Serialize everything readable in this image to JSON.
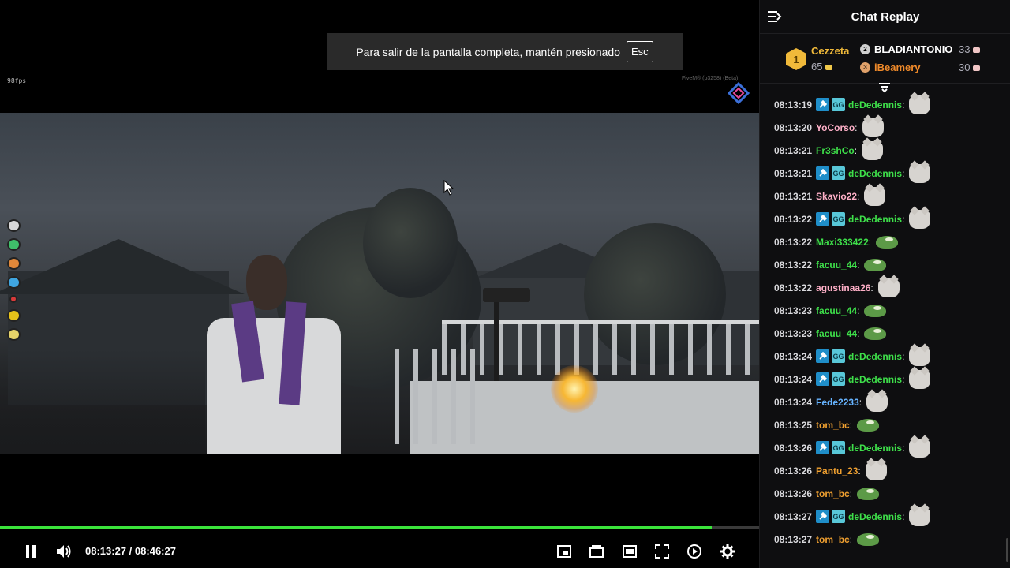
{
  "fullscreen_notice": {
    "text": "Para salir de la pantalla completa, mantén presionado",
    "key": "Esc"
  },
  "game": {
    "fps": "98fps",
    "watermark": "FiveM® (b3258) (Beta)"
  },
  "player": {
    "progress_fraction": 0.938,
    "current_time": "08:13:27",
    "separator": "/",
    "duration": "08:46:27",
    "colors": {
      "progress": "#3be43b"
    },
    "controls": [
      "pause-icon",
      "volume-icon",
      "miniplayer-icon",
      "theater-icon",
      "window-icon",
      "fullscreen-icon",
      "playback-speed-icon",
      "gear-icon"
    ]
  },
  "chat": {
    "title": "Chat Replay",
    "leaderboard": {
      "first": {
        "rank": "1",
        "name": "Cezzeta",
        "points": "65"
      },
      "others": [
        {
          "rank": "2",
          "name": "BLADIANTONIO",
          "points": "33",
          "color": "#ffffff"
        },
        {
          "rank": "3",
          "name": "iBeamery",
          "points": "30",
          "color": "#f08a2a"
        }
      ]
    },
    "messages": [
      {
        "time": "08:13:19",
        "user": "deDedennis",
        "color": "#3ee04a",
        "badges": true,
        "emote": "cat"
      },
      {
        "time": "08:13:20",
        "user": "YoCorso",
        "color": "#ffb0c8",
        "badges": false,
        "emote": "cat"
      },
      {
        "time": "08:13:21",
        "user": "Fr3shCo",
        "color": "#3ee04a",
        "badges": false,
        "emote": "cat"
      },
      {
        "time": "08:13:21",
        "user": "deDedennis",
        "color": "#3ee04a",
        "badges": true,
        "emote": "cat"
      },
      {
        "time": "08:13:21",
        "user": "Skavio22",
        "color": "#ffb0c8",
        "badges": false,
        "emote": "cat"
      },
      {
        "time": "08:13:22",
        "user": "deDedennis",
        "color": "#3ee04a",
        "badges": true,
        "emote": "cat"
      },
      {
        "time": "08:13:22",
        "user": "Maxi333422",
        "color": "#3ee04a",
        "badges": false,
        "emote": "frog"
      },
      {
        "time": "08:13:22",
        "user": "facuu_44",
        "color": "#3ee04a",
        "badges": false,
        "emote": "frog"
      },
      {
        "time": "08:13:22",
        "user": "agustinaa26",
        "color": "#ffb0c8",
        "badges": false,
        "emote": "cat"
      },
      {
        "time": "08:13:23",
        "user": "facuu_44",
        "color": "#3ee04a",
        "badges": false,
        "emote": "frog"
      },
      {
        "time": "08:13:23",
        "user": "facuu_44",
        "color": "#3ee04a",
        "badges": false,
        "emote": "frog"
      },
      {
        "time": "08:13:24",
        "user": "deDedennis",
        "color": "#3ee04a",
        "badges": true,
        "emote": "cat"
      },
      {
        "time": "08:13:24",
        "user": "deDedennis",
        "color": "#3ee04a",
        "badges": true,
        "emote": "cat"
      },
      {
        "time": "08:13:24",
        "user": "Fede2233",
        "color": "#66b3ff",
        "badges": false,
        "emote": "cat"
      },
      {
        "time": "08:13:25",
        "user": "tom_bc",
        "color": "#f0a030",
        "badges": false,
        "emote": "frog"
      },
      {
        "time": "08:13:26",
        "user": "deDedennis",
        "color": "#3ee04a",
        "badges": true,
        "emote": "cat"
      },
      {
        "time": "08:13:26",
        "user": "Pantu_23",
        "color": "#f0a030",
        "badges": false,
        "emote": "cat"
      },
      {
        "time": "08:13:26",
        "user": "tom_bc",
        "color": "#f0a030",
        "badges": false,
        "emote": "frog"
      },
      {
        "time": "08:13:27",
        "user": "deDedennis",
        "color": "#3ee04a",
        "badges": true,
        "emote": "cat"
      },
      {
        "time": "08:13:27",
        "user": "tom_bc",
        "color": "#f0a030",
        "badges": false,
        "emote": "frog"
      }
    ]
  }
}
